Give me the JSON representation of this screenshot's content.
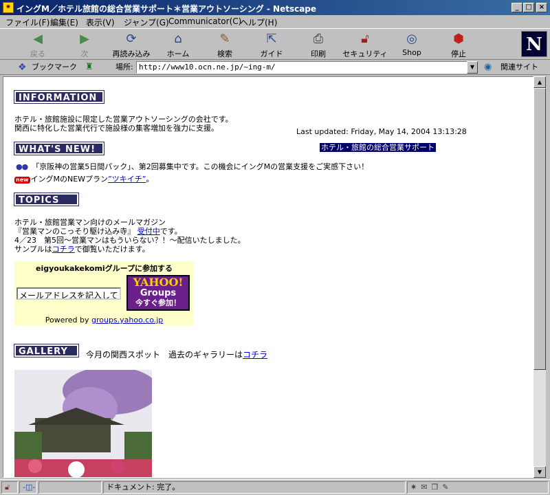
{
  "window": {
    "title": "イングM／ホテル旅館の総合営業サポート＊営業アウトソーシング - Netscape",
    "app_icon": "netscape-app-icon",
    "controls": [
      "_",
      "□",
      "×"
    ]
  },
  "menu": [
    "ファイル(F)",
    "編集(E)",
    "表示(V)",
    "ジャンプ(G)",
    "Communicator(C)",
    "ヘルプ(H)"
  ],
  "toolbar": {
    "buttons": [
      {
        "label": "戻る",
        "icon": "back-arrow-icon",
        "enabled": false
      },
      {
        "label": "次",
        "icon": "forward-arrow-icon",
        "enabled": false
      },
      {
        "label": "再読み込み",
        "icon": "reload-icon",
        "enabled": true
      },
      {
        "label": "ホーム",
        "icon": "home-icon",
        "enabled": true
      },
      {
        "label": "検索",
        "icon": "search-icon",
        "enabled": true
      },
      {
        "label": "ガイド",
        "icon": "guide-icon",
        "enabled": true
      },
      {
        "label": "印刷",
        "icon": "print-icon",
        "enabled": true
      },
      {
        "label": "セキュリティ",
        "icon": "security-lock-icon",
        "enabled": true
      },
      {
        "label": "Shop",
        "icon": "shop-icon",
        "enabled": true
      },
      {
        "label": "停止",
        "icon": "stop-icon",
        "enabled": true
      }
    ],
    "logo": "N"
  },
  "location": {
    "bookmarks_label": "ブックマーク",
    "location_label": "場所:",
    "url": "http://www10.ocn.ne.jp/~ing-m/",
    "related_label": "関連サイト"
  },
  "page": {
    "information": {
      "header": "INFORMATION",
      "line1": "ホテル・旅館施設に限定した営業アウトソーシングの会社です。",
      "line2": "関西に特化した営業代行で施設様の集客増加を強力に支援。",
      "last_updated": "Last updated: Friday, May 14, 2004 13:13:28",
      "marquee": "ホテル・旅館の総合営業サポート"
    },
    "whats_new": {
      "header": "WHAT'S NEW!",
      "item1": "「京阪神の営業5日間パック」、第2回募集中です。この機会にイングMの営業支援をご実感下さい！",
      "new_badge": "new",
      "item2_prefix": "イングMのNEWプラン",
      "item2_link": "”ツキイチ”",
      "item2_suffix": "。"
    },
    "topics": {
      "header": "TOPICS",
      "line1": "ホテル・旅館営業マン向けのメールマガジン",
      "line2_prefix": "『営業マンのこっそり駆け込み寺』",
      "line2_link": "受付中",
      "line2_suffix": "です。",
      "line3": "4／23　第5回～営業マンはもういらない？！～配信いたしました。",
      "line4_prefix": "サンプルは",
      "line4_link": "コチラ",
      "line4_suffix": "で御覧いただけます。"
    },
    "yahoo": {
      "title": "eigyoukakekomiグループに参加する",
      "email_placeholder": "メールアドレスを記入して",
      "btn_line1": "YAHOO!",
      "btn_line2": "Groups",
      "btn_line3": "今すぐ参加！",
      "powered_prefix": "Powered by ",
      "powered_link": "groups.yahoo.co.jp"
    },
    "gallery": {
      "header": "GALLERY",
      "text_prefix": "今月の関西スポット　過去のギャラリーは",
      "text_link": "コチラ"
    }
  },
  "status": {
    "text": "ドキュメント: 完了。"
  }
}
